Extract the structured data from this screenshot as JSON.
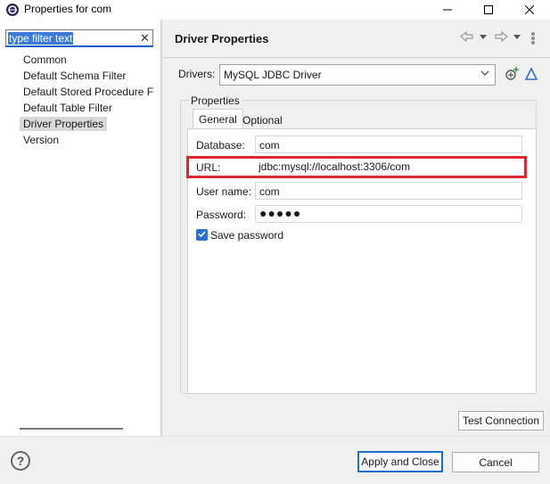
{
  "window": {
    "title": "Properties for com",
    "minimize_icon": "minimize-icon",
    "maximize_icon": "maximize-icon",
    "close_icon": "close-icon"
  },
  "filter": {
    "text": "type filter text",
    "clear_glyph": "✕"
  },
  "nav": {
    "items": [
      {
        "label": "Common"
      },
      {
        "label": "Default Schema Filter"
      },
      {
        "label": "Default Stored Procedure F"
      },
      {
        "label": "Default Table Filter"
      },
      {
        "label": "Driver Properties",
        "selected": true
      },
      {
        "label": "Version"
      }
    ]
  },
  "page": {
    "title": "Driver Properties"
  },
  "drivers": {
    "label": "Drivers:",
    "value": "MySQL JDBC Driver"
  },
  "properties": {
    "group_label": "Properties",
    "tabs": [
      {
        "label": "General",
        "active": true
      },
      {
        "label": "Optional",
        "active": false
      }
    ],
    "fields": {
      "database_label": "Database:",
      "database_value": "com",
      "url_label": "URL:",
      "url_value": "jdbc:mysql://localhost:3306/com",
      "user_label": "User name:",
      "user_value": "com",
      "password_label": "Password:",
      "password_masked": "●●●●●"
    },
    "save_password_label": "Save password",
    "save_password_checked": true
  },
  "buttons": {
    "test_connection": "Test Connection",
    "apply_close": "Apply and Close",
    "cancel": "Cancel"
  },
  "colors": {
    "accent": "#1e6fd0",
    "highlight": "#e0262e"
  }
}
